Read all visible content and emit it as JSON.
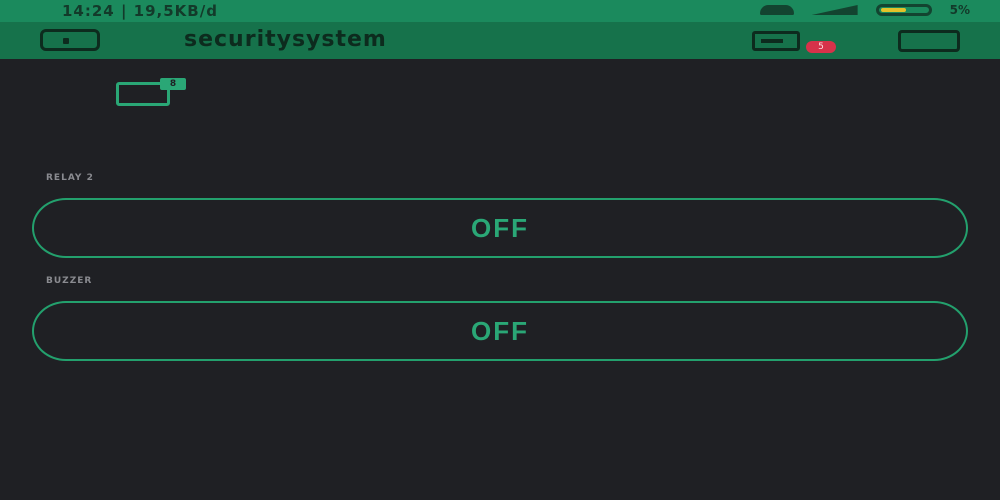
{
  "status_bar": {
    "time_speed": "14:24 | 19,5KB/d",
    "battery_pct": "5%",
    "battery_level": 0.55,
    "icons": [
      "wifi-icon",
      "signal-icon",
      "battery-icon"
    ]
  },
  "app_bar": {
    "title": "securitysystem",
    "notification_count": "5",
    "icons": [
      "back-icon",
      "device-icon",
      "menu-icon"
    ]
  },
  "device_widget": {
    "tag": "8"
  },
  "widgets": [
    {
      "label": "RELAY 2",
      "value": "OFF"
    },
    {
      "label": "BUZZER",
      "value": "OFF"
    }
  ],
  "colors": {
    "accent": "#1b8a5d",
    "app_bar": "#16724b",
    "background": "#1f2024",
    "switch_text": "#2aa776",
    "badge": "#d6324a"
  }
}
